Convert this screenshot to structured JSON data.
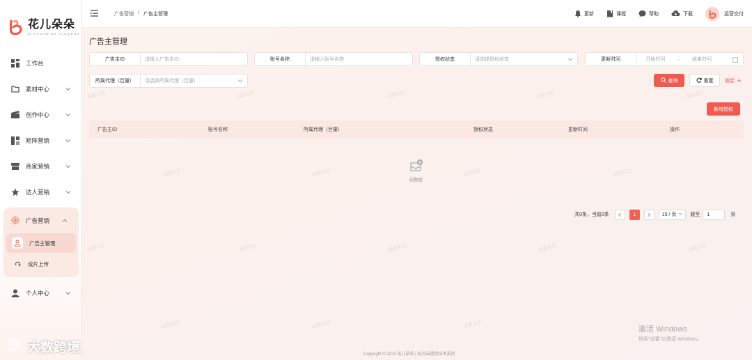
{
  "app": {
    "logo_cn": "花儿朵朵",
    "logo_en": "BLOSSOMING FLOWERS"
  },
  "sidebar": {
    "items": [
      {
        "label": "工作台",
        "icon": "dashboard-icon"
      },
      {
        "label": "素材中心",
        "icon": "folder-icon"
      },
      {
        "label": "创作中心",
        "icon": "clapperboard-icon"
      },
      {
        "label": "矩阵营销",
        "icon": "matrix-icon"
      },
      {
        "label": "商家营销",
        "icon": "store-icon"
      },
      {
        "label": "达人营销",
        "icon": "star-icon"
      },
      {
        "label": "广告营销",
        "icon": "gear-flower-icon"
      },
      {
        "label": "个人中心",
        "icon": "user-icon"
      }
    ],
    "ad_sub": {
      "active": "广告主管理",
      "other": "成片上传"
    }
  },
  "header": {
    "breadcrumb": [
      "广告营销",
      "/",
      "广告主管理"
    ],
    "actions": [
      "更新",
      "课程",
      "帮助",
      "下载"
    ],
    "user": "运营交付"
  },
  "page": {
    "title": "广告主管理"
  },
  "filters": {
    "advertiser_id": {
      "label": "广告主ID",
      "placeholder": "请输入广告主ID"
    },
    "account_name": {
      "label": "账号名称",
      "placeholder": "请输入账号名称"
    },
    "auth_status": {
      "label": "授权状态",
      "placeholder": "请选择授权状态"
    },
    "update_time": {
      "label": "更新时间",
      "start": "开始时间",
      "arrow": "→",
      "end": "结束时间"
    },
    "agency": {
      "label": "所属代理（巨量）",
      "placeholder": "请选择所属代理（巨量）"
    }
  },
  "buttons": {
    "query": "查询",
    "reset": "重置",
    "collapse": "收起",
    "add": "新增授权"
  },
  "table": {
    "columns": [
      "广告主ID",
      "账号名称",
      "所属代理（巨量）",
      "授权状态",
      "更新时间",
      "操作"
    ],
    "rows": [],
    "empty_text": "无数据"
  },
  "pagination": {
    "summary": "共0条，当前0条",
    "current": "1",
    "page_size": "15 / 页",
    "jump_label": "跳至",
    "jump_value": "1",
    "page_unit": "页"
  },
  "watermark": "运营交付",
  "footer": "Copyright © 2024 花儿朵朵 | 标点云提供技术支持",
  "windows": {
    "line1": "激活 Windows",
    "line2": "转到\"设置\"以激活 Windows。"
  },
  "overlay_brand": "大数跨境",
  "colors": {
    "accent": "#f05a50",
    "header_row": "#fbe8e2",
    "active_bg": "#fbe9e4"
  }
}
